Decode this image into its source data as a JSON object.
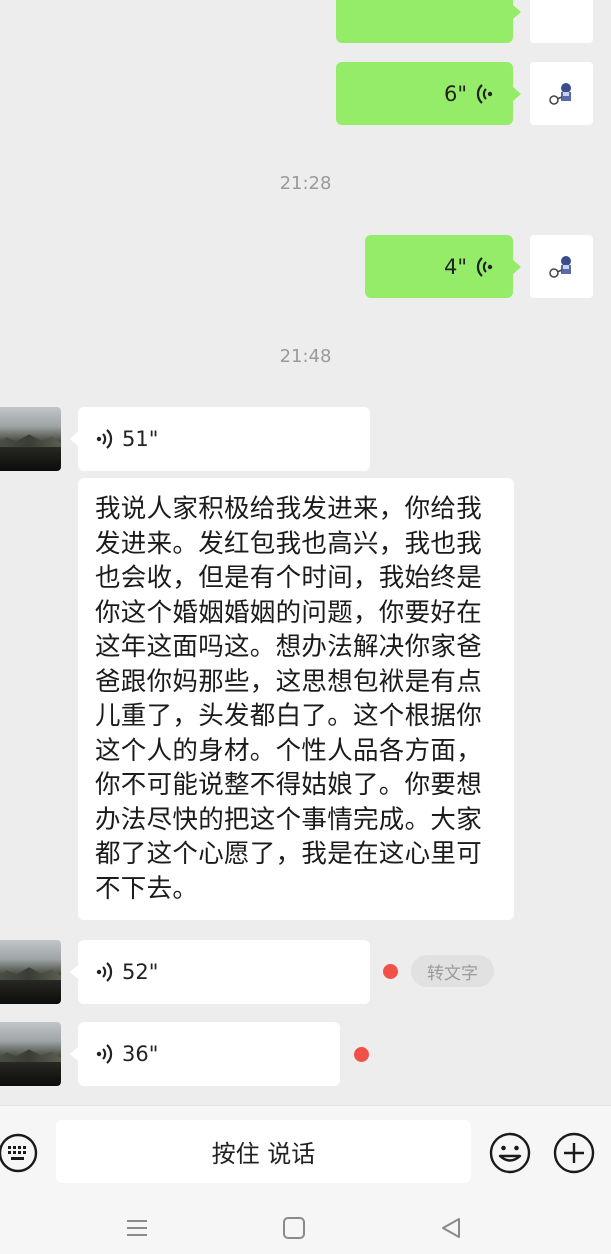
{
  "messages": {
    "sent_voice_1": {
      "duration": "6\""
    },
    "time_1": "21:28",
    "sent_voice_2": {
      "duration": "4\""
    },
    "time_2": "21:48",
    "recv_voice_1": {
      "duration": "51\""
    },
    "transcript_text": "我说人家积极给我发进来，你给我发进来。发红包我也高兴，我也我也会收，但是有个时间，我始终是你这个婚姻婚姻的问题，你要好在这年这面吗这。想办法解决你家爸爸跟你妈那些，这思想包袱是有点儿重了，头发都白了。这个根据你这个人的身材。个性人品各方面，你不可能说整不得姑娘了。你要想办法尽快的把这个事情完成。大家都了这个心愿了，我是在这心里可不下去。",
    "recv_voice_2": {
      "duration": "52\"",
      "to_text_label": "转文字"
    },
    "recv_voice_3": {
      "duration": "36\""
    }
  },
  "input_bar": {
    "hold_to_talk_label": "按住 说话"
  },
  "icons": {
    "voice_wave": "voice-wave-icon",
    "keyboard": "keyboard-icon",
    "emoji": "emoji-icon",
    "plus": "plus-icon",
    "menu": "menu-icon",
    "home": "home-icon",
    "back": "back-icon"
  },
  "colors": {
    "chat_background": "#ededed",
    "sent_bubble": "#95ec69",
    "received_bubble": "#ffffff",
    "unread_dot": "#f25148"
  }
}
